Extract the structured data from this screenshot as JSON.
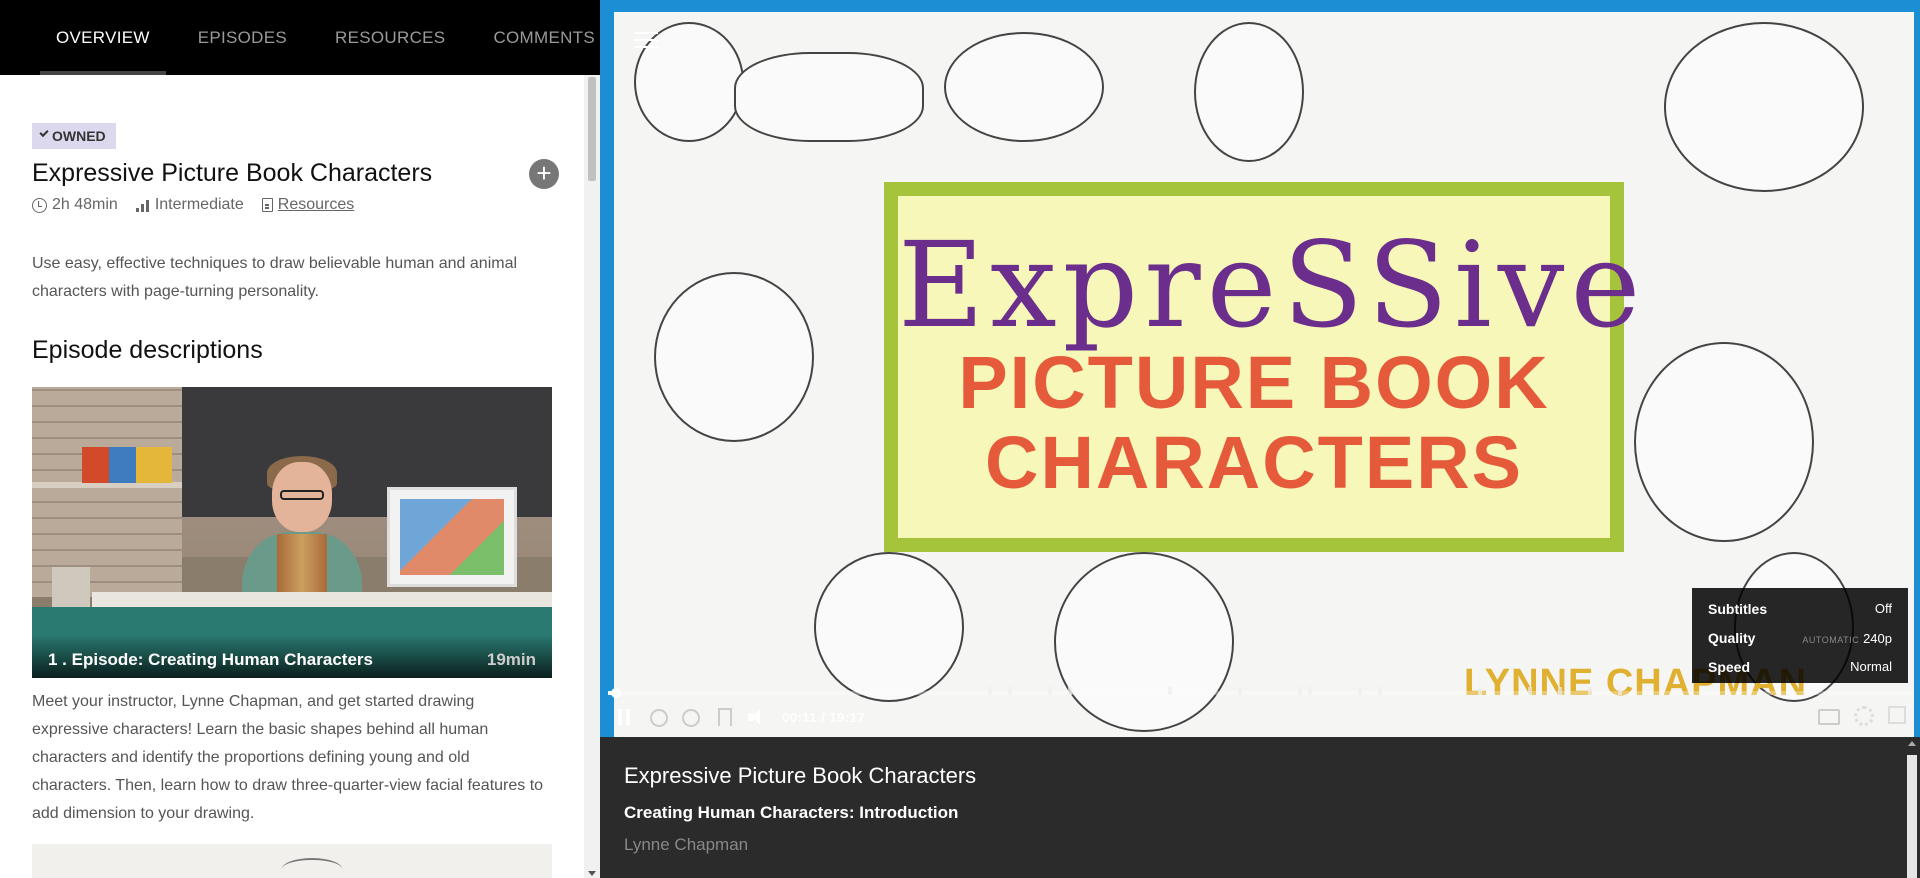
{
  "tabs": [
    {
      "label": "OVERVIEW",
      "active": true
    },
    {
      "label": "EPISODES",
      "active": false
    },
    {
      "label": "RESOURCES",
      "active": false
    },
    {
      "label": "COMMENTS",
      "active": false
    }
  ],
  "course": {
    "badge": "OWNED",
    "title": "Expressive Picture Book Characters",
    "duration": "2h 48min",
    "level": "Intermediate",
    "resources_link": "Resources",
    "add_icon": "plus-circle-icon",
    "description": "Use easy, effective techniques to draw believable human and animal characters with page-turning personality."
  },
  "episodes_section": {
    "heading": "Episode descriptions",
    "items": [
      {
        "title": "1 . Episode: Creating Human Characters",
        "duration": "19min",
        "description": "Meet your instructor, Lynne Chapman, and get started drawing expressive characters! Learn the basic shapes behind all human characters and identify the proportions defining young and old characters. Then, learn how to draw three-quarter-view facial features to add dimension to your drawing."
      }
    ]
  },
  "video": {
    "card_line1": "ExpreSSive",
    "card_line2": "PICTURE BOOK",
    "card_line3": "CHARACTERS",
    "author_mark": "LYNNE CHAPMAN",
    "progress_fraction": 0.0096,
    "current_time": "00:11",
    "total_time": "19:17",
    "time_separator": "/",
    "icons": [
      "pause-icon",
      "rewind-icon",
      "forward-icon",
      "bookmark-icon",
      "volume-icon",
      "cast-icon",
      "gear-icon",
      "fullscreen-icon",
      "menu-icon"
    ]
  },
  "settings": {
    "subtitles_label": "Subtitles",
    "subtitles_value": "Off",
    "quality_label": "Quality",
    "quality_mode": "AUTOMATIC",
    "quality_value": "240p",
    "speed_label": "Speed",
    "speed_value": "Normal"
  },
  "info": {
    "title": "Expressive Picture Book Characters",
    "subtitle": "Creating Human Characters: Introduction",
    "author": "Lynne Chapman"
  },
  "colors": {
    "accent_blue": "#1c8fd4",
    "card_green": "#a6c43b",
    "badge_bg": "#dcd8ee",
    "title_purple": "#6c2e8c",
    "title_red": "#e55a3a"
  }
}
